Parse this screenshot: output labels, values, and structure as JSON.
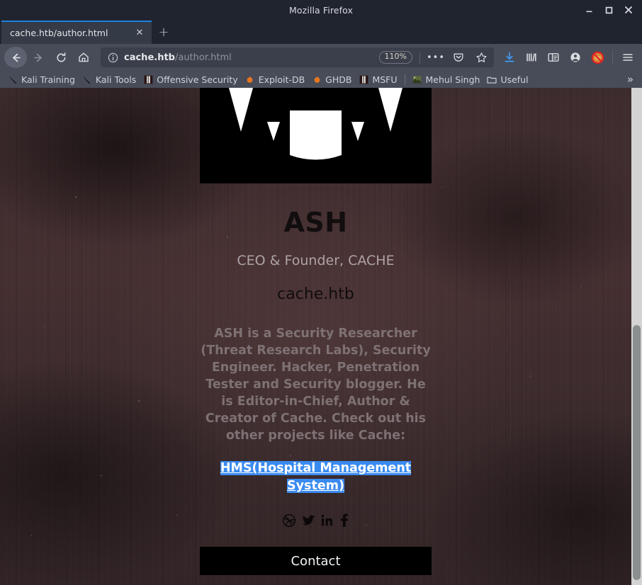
{
  "window": {
    "title": "Mozilla Firefox",
    "controls": [
      {
        "name": "minimize",
        "glyph": "minimize-icon"
      },
      {
        "name": "maximize",
        "glyph": "maximize-icon"
      },
      {
        "name": "close",
        "glyph": "close-icon"
      }
    ]
  },
  "tabs": {
    "active_index": 0,
    "items": [
      {
        "title": "cache.htb/author.html",
        "close_label": "✕"
      }
    ],
    "new_tab_label": "+"
  },
  "toolbar": {
    "back": "back-arrow-icon",
    "forward": "forward-arrow-icon",
    "reload": "reload-icon",
    "home": "home-icon",
    "url": {
      "info_icon": "page-info-icon",
      "host": "cache.htb",
      "path": "/author.html",
      "full": "cache.htb/author.html",
      "zoom_level": "110%",
      "page_actions_label": "•••",
      "pocket_icon": "pocket-icon",
      "bookmark_icon": "star-icon"
    },
    "icons": [
      {
        "name": "downloads-icon",
        "label": "Downloads"
      },
      {
        "name": "library-icon",
        "label": "Library"
      },
      {
        "name": "sidebar-icon",
        "label": "Sidebars"
      },
      {
        "name": "account-icon",
        "label": "Account"
      },
      {
        "name": "noscript-icon",
        "label": "NoScript"
      },
      {
        "name": "menu-icon",
        "label": "Open menu"
      }
    ]
  },
  "bookmarks": {
    "items": [
      {
        "label": "Kali Training",
        "icon": "kali-dragon-icon"
      },
      {
        "label": "Kali Tools",
        "icon": "kali-dragon-icon"
      },
      {
        "label": "Offensive Security",
        "icon": "offsec-icon"
      },
      {
        "label": "Exploit-DB",
        "icon": "exploitdb-flame-icon"
      },
      {
        "label": "GHDB",
        "icon": "exploitdb-flame-icon"
      },
      {
        "label": "MSFU",
        "icon": "offsec-icon"
      },
      {
        "separator": true
      },
      {
        "label": "Mehul Singh",
        "icon": "photo-icon"
      },
      {
        "label": "Useful",
        "icon": "folder-icon"
      }
    ],
    "overflow_label": "»"
  },
  "page": {
    "avatar_alt": "ash-avatar-image",
    "name": "ASH",
    "role": "CEO & Founder, CACHE",
    "site": "cache.htb",
    "bio": "ASH is a Security Researcher (Threat Research Labs), Security Engineer. Hacker, Penetration Tester and Security blogger. He is Editor-in-Chief, Author & Creator of Cache. Check out his other projects like Cache:",
    "project_link": "HMS(Hospital Management System)",
    "project_link_selected": true,
    "socials": [
      {
        "name": "dribbble-icon",
        "label": "Dribbble"
      },
      {
        "name": "twitter-icon",
        "label": "Twitter"
      },
      {
        "name": "linkedin-icon",
        "label": "LinkedIn"
      },
      {
        "name": "facebook-icon",
        "label": "Facebook"
      }
    ],
    "contact_button": "Contact",
    "colors": {
      "background": "#3b2a2c",
      "selection": "#3a8bf0",
      "name_text": "#120d0e",
      "role_text": "#ada3a5",
      "bio_text": "#7e7173",
      "button_bg": "#000000"
    }
  }
}
